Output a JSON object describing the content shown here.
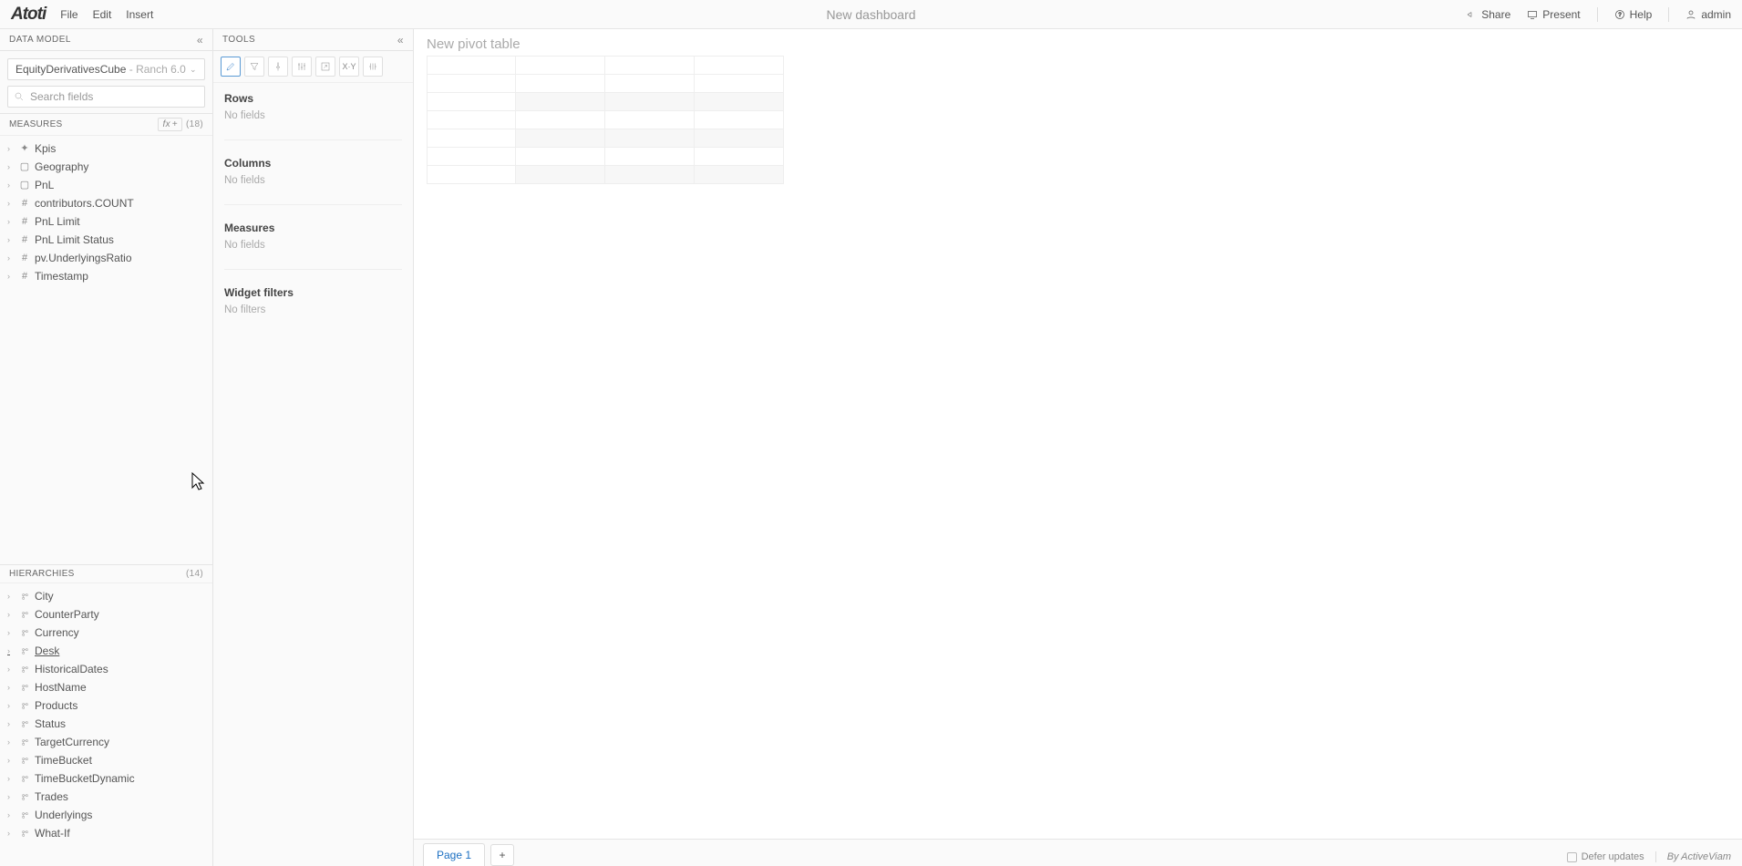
{
  "topbar": {
    "logo": "Atoti",
    "menu": [
      "File",
      "Edit",
      "Insert"
    ],
    "title": "New dashboard",
    "share": "Share",
    "present": "Present",
    "help": "Help",
    "user": "admin"
  },
  "data_model": {
    "header": "DATA MODEL",
    "cube_name": "EquityDerivativesCube",
    "cube_version": "Ranch 6.0",
    "search_placeholder": "Search fields",
    "measures_header": "MEASURES",
    "fx_label": "fx",
    "measures_count": "(18)",
    "measures": [
      {
        "icon": "sparkle",
        "label": "Kpis"
      },
      {
        "icon": "folder",
        "label": "Geography"
      },
      {
        "icon": "folder",
        "label": "PnL"
      },
      {
        "icon": "hash",
        "label": "contributors.COUNT"
      },
      {
        "icon": "hash",
        "label": "PnL Limit"
      },
      {
        "icon": "hash",
        "label": "PnL Limit Status"
      },
      {
        "icon": "hash",
        "label": "pv.UnderlyingsRatio"
      },
      {
        "icon": "hash",
        "label": "Timestamp"
      }
    ],
    "hierarchies_header": "HIERARCHIES",
    "hierarchies_count": "(14)",
    "hierarchies": [
      "City",
      "CounterParty",
      "Currency",
      "Desk",
      "HistoricalDates",
      "HostName",
      "Products",
      "Status",
      "TargetCurrency",
      "TimeBucket",
      "TimeBucketDynamic",
      "Trades",
      "Underlyings",
      "What-If"
    ],
    "hovered_index": 3
  },
  "tools": {
    "header": "TOOLS",
    "icons": [
      "edit",
      "filter",
      "pin",
      "settings",
      "expand",
      "xy",
      "columns"
    ],
    "sections": [
      {
        "title": "Rows",
        "empty": "No fields"
      },
      {
        "title": "Columns",
        "empty": "No fields"
      },
      {
        "title": "Measures",
        "empty": "No fields"
      },
      {
        "title": "Widget filters",
        "empty": "No filters"
      }
    ]
  },
  "canvas": {
    "widget_title": "New pivot table",
    "page_label": "Page 1"
  },
  "status": {
    "defer": "Defer updates",
    "byline": "By ActiveViam"
  }
}
